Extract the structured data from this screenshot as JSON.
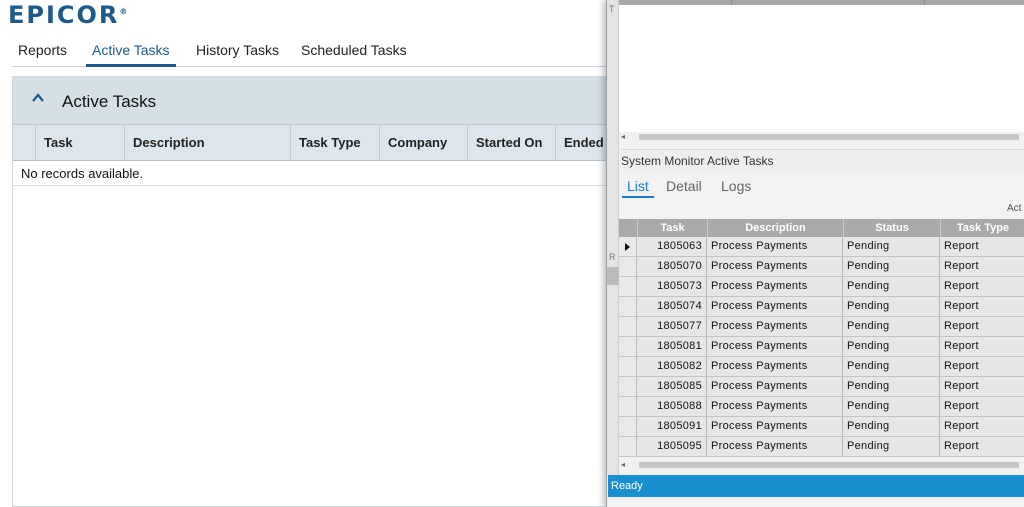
{
  "web": {
    "logo": "epicor",
    "tabs": [
      "Reports",
      "Active Tasks",
      "History Tasks",
      "Scheduled Tasks"
    ],
    "panel_title": "Active Tasks",
    "columns": [
      "Task",
      "Description",
      "Task Type",
      "Company",
      "Started On",
      "Ended O"
    ],
    "empty_message": "No records available."
  },
  "monitor": {
    "strip_letter_t": "T",
    "strip_letter_r": "R",
    "title": "System Monitor Active Tasks",
    "tabs": [
      "List",
      "Detail",
      "Logs"
    ],
    "grid_caption": "Act",
    "columns": [
      "Task",
      "Description",
      "Status",
      "Task Type"
    ],
    "rows": [
      [
        "1805063",
        "Process Payments",
        "Pending",
        "Report"
      ],
      [
        "1805070",
        "Process Payments",
        "Pending",
        "Report"
      ],
      [
        "1805073",
        "Process Payments",
        "Pending",
        "Report"
      ],
      [
        "1805074",
        "Process Payments",
        "Pending",
        "Report"
      ],
      [
        "1805077",
        "Process Payments",
        "Pending",
        "Report"
      ],
      [
        "1805081",
        "Process Payments",
        "Pending",
        "Report"
      ],
      [
        "1805082",
        "Process Payments",
        "Pending",
        "Report"
      ],
      [
        "1805085",
        "Process Payments",
        "Pending",
        "Report"
      ],
      [
        "1805088",
        "Process Payments",
        "Pending",
        "Report"
      ],
      [
        "1805091",
        "Process Payments",
        "Pending",
        "Report"
      ],
      [
        "1805095",
        "Process Payments",
        "Pending",
        "Report"
      ]
    ],
    "status_text": "Ready"
  },
  "colors": {
    "brand": "#1d5a8a",
    "status_bar": "#1a8fd0",
    "active_tab": "#1a7cc9"
  }
}
